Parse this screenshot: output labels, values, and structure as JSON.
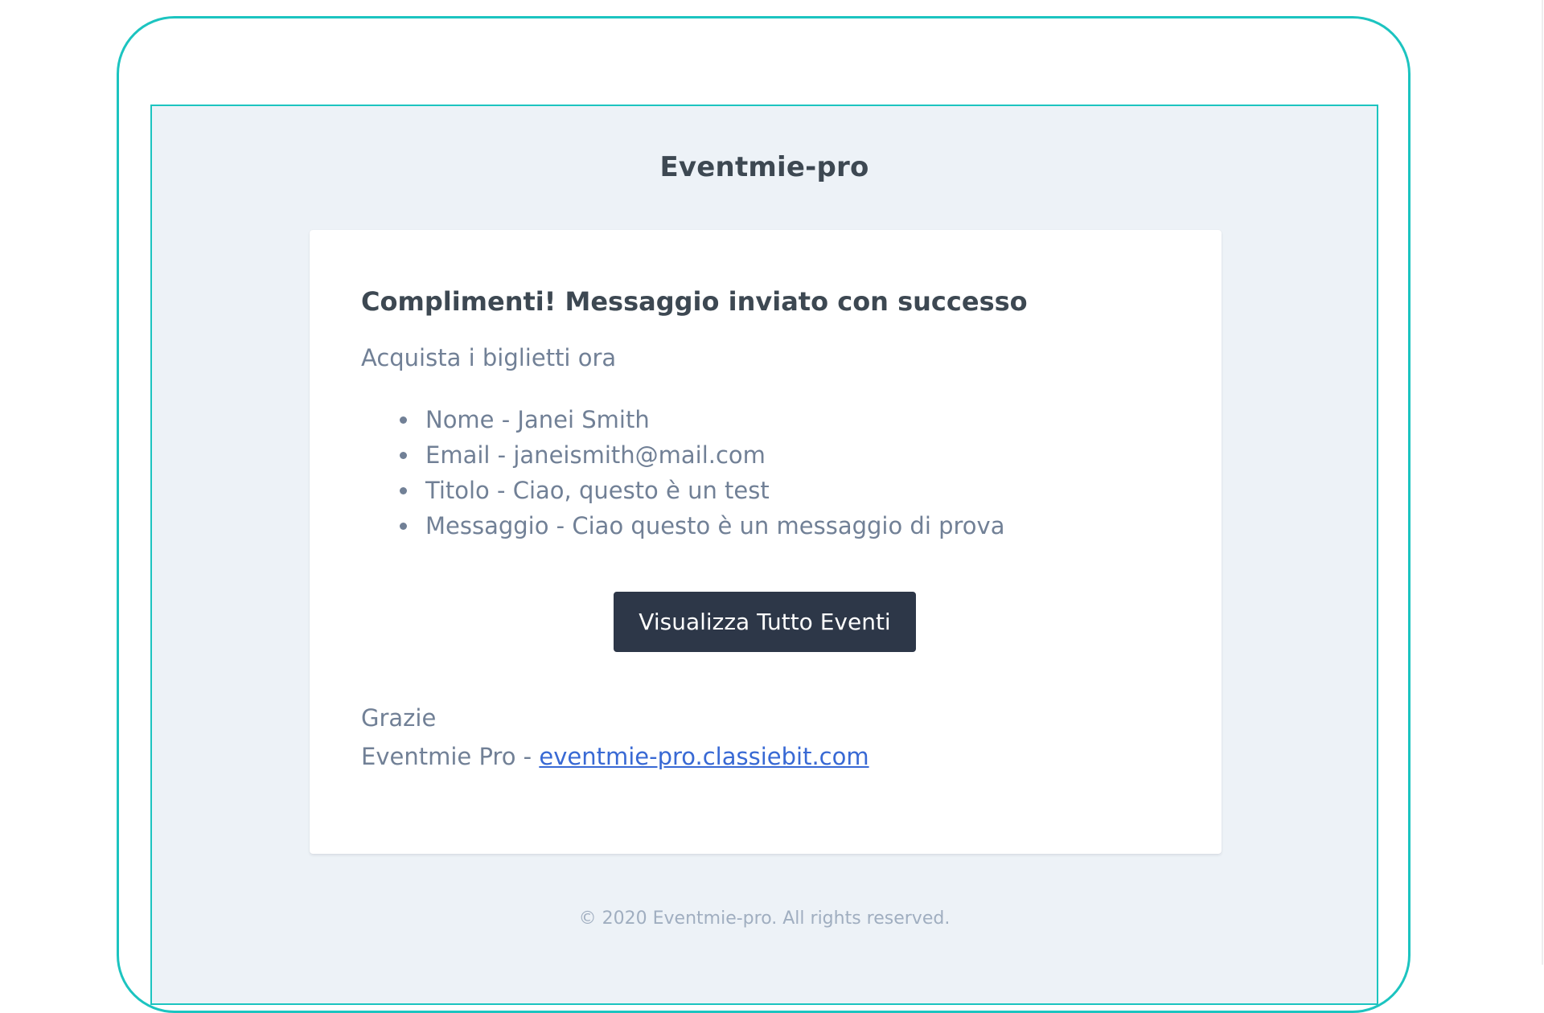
{
  "email": {
    "brand": "Eventmie-pro",
    "title": "Complimenti! Messaggio inviato con successo",
    "intro": "Acquista i biglietti ora",
    "details": [
      "Nome - Janei Smith",
      "Email - janeismith@mail.com",
      "Titolo - Ciao, questo è un test",
      "Messaggio - Ciao questo è un messaggio di prova"
    ],
    "button_label": "Visualizza Tutto Eventi",
    "thanks": "Grazie",
    "signature_prefix": "Eventmie Pro - ",
    "signature_link": "eventmie-pro.classiebit.com",
    "footer": "© 2020 Eventmie-pro. All rights reserved."
  },
  "colors": {
    "frame": "#1cc4c0",
    "background": "#edf2f7",
    "heading": "#3d4852",
    "text": "#718096",
    "button": "#2d3748",
    "link": "#3869d4",
    "footer": "#a0aec0"
  }
}
